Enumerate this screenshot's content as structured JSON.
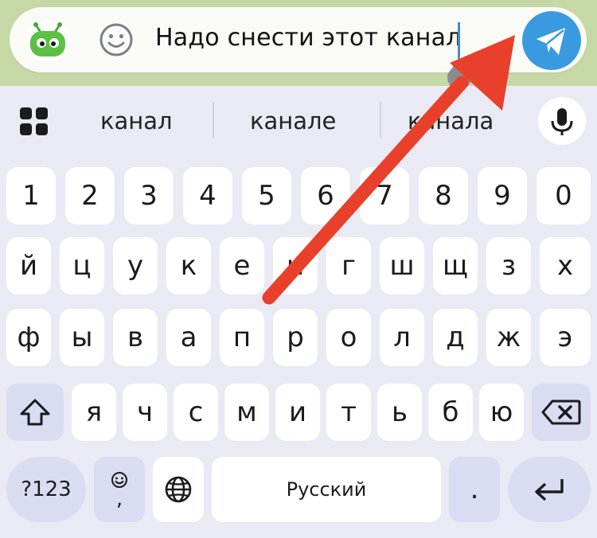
{
  "message_input": {
    "text": "Надо снести этот канал"
  },
  "suggestions": [
    "канал",
    "канале",
    "канала"
  ],
  "keyboard": {
    "digits": [
      "1",
      "2",
      "3",
      "4",
      "5",
      "6",
      "7",
      "8",
      "9",
      "0"
    ],
    "row1": [
      "й",
      "ц",
      "у",
      "к",
      "е",
      "н",
      "г",
      "ш",
      "щ",
      "з",
      "х"
    ],
    "row2": [
      "ф",
      "ы",
      "в",
      "а",
      "п",
      "р",
      "о",
      "л",
      "д",
      "ж",
      "э"
    ],
    "row3": [
      "я",
      "ч",
      "с",
      "м",
      "и",
      "т",
      "ь",
      "б",
      "ю"
    ],
    "symbols_label": "?123",
    "emoji_key_sub": ",",
    "space_label": "Русский",
    "period_label": "."
  },
  "colors": {
    "send_button": "#3a9ae0",
    "annotation_arrow": "#e8402a",
    "bot_avatar": "#5cc044"
  },
  "icons": [
    "bot-avatar-icon",
    "emoji-icon",
    "send-icon",
    "grid-icon",
    "mic-icon",
    "shift-icon",
    "backspace-icon",
    "globe-icon",
    "enter-icon"
  ]
}
